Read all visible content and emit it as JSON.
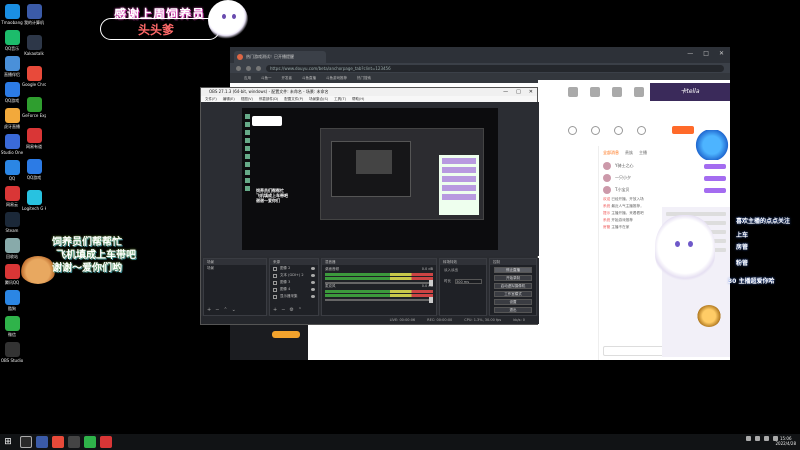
{
  "desktop": {
    "icons": [
      {
        "label": "Tmaobang",
        "color": "#1a8fe3"
      },
      {
        "label": "我的计算机",
        "color": "#3b5ba8"
      },
      {
        "label": "QQ音乐",
        "color": "#1cbc6b"
      },
      {
        "label": "Kakaotalk",
        "color": "#2d3748"
      },
      {
        "label": "直播伴侣",
        "color": "#4a90d9"
      },
      {
        "label": "Google Chrome",
        "color": "#e84a3a"
      },
      {
        "label": "QQ游戏",
        "color": "#2c7be5"
      },
      {
        "label": "GeForce Experience",
        "color": "#2f9e2f"
      },
      {
        "label": "虎牙直播",
        "color": "#f2a93b"
      },
      {
        "label": "网易有道",
        "color": "#d93636"
      },
      {
        "label": "Studio One",
        "color": "#3a6ad8"
      },
      {
        "label": "QQ",
        "color": "#2b86e4"
      },
      {
        "label": "QQ游戏",
        "color": "#2c7be5"
      },
      {
        "label": "网易云",
        "color": "#d93636"
      },
      {
        "label": "Logitech G HUB",
        "color": "#28c2e0"
      },
      {
        "label": "Steam",
        "color": "#1b2838"
      },
      {
        "label": "回收站",
        "color": "#8aa"
      },
      {
        "label": "腾讯QQ",
        "color": "#d93636"
      },
      {
        "label": "酷狗",
        "color": "#2b86e4"
      },
      {
        "label": "微信",
        "color": "#2fb34a"
      },
      {
        "label": "OBS Studio",
        "color": "#333"
      }
    ]
  },
  "overlay": {
    "thanks_title": "感谢上周饲养员",
    "thanks_name": "头头爹",
    "left_msg": [
      "饲养员们帮帮忙",
      "飞机填成上车带吧",
      "谢谢～爱你们哟"
    ],
    "follow_title": "喜欢主播的点点关注",
    "follow_lines": [
      "上车",
      "房管",
      "粉管"
    ],
    "follow_bottom": "30 主播超爱你哈",
    "banner_right": "卡tella"
  },
  "browser": {
    "tab_title": "热门游戏测试！已开播提醒",
    "url": "https://www.douyu.com/beta/anchorpage_tab?clint=123456",
    "bookmarks": [
      "应用",
      "斗鱼一",
      "开发者",
      "斗鱼直播",
      "斗鱼游戏推荐",
      "热门搜索"
    ],
    "window_controls": [
      "—",
      "□",
      "✕"
    ],
    "chat_tabs": [
      "全部消息",
      "贵族",
      "主播"
    ],
    "rank_rows": [
      "Y骑士之心",
      "一只小夕",
      "T小宝贝"
    ],
    "chat_messages": [
      {
        "who": "欢迎",
        "text": "已经开播，开放入场"
      },
      {
        "who": "系统",
        "text": "最近人气主播推荐，"
      },
      {
        "who": "提示",
        "text": "主播开播，来看看吧"
      },
      {
        "who": "系统",
        "text": "开始游戏推荐"
      },
      {
        "who": "房管",
        "text": "主播不在家"
      }
    ]
  },
  "obs": {
    "title": "OBS 27.1.3 (64-bit, windows) - 配置文件: 未命名 - 场景: 未命名",
    "menu": [
      "文件(F)",
      "编辑(E)",
      "视图(V)",
      "停靠部件(D)",
      "配置文件(P)",
      "场景集合(S)",
      "工具(T)",
      "帮助(H)"
    ],
    "preview_text": [
      "饲养员们帮帮忙",
      "飞机填成上车带吧",
      "谢谢～爱你们"
    ],
    "dock_titles": [
      "场景",
      "来源",
      "混音器",
      "转场特效",
      "控制"
    ],
    "scenes": [
      "场景"
    ],
    "sources": [
      "图像 2",
      "文本 (GDI+) 2",
      "图像 3",
      "图像 4",
      "显示器采集"
    ],
    "mixer": [
      {
        "name": "桌面音频",
        "value": "0.0 dB"
      },
      {
        "name": "麦克风",
        "value": "0.0 dB"
      }
    ],
    "transition": {
      "label": "淡入淡出",
      "duration_label": "时长",
      "duration": "300 ms"
    },
    "controls": [
      "停止直播",
      "开始录制",
      "启动虚拟摄像机",
      "工作室模式",
      "设置",
      "退出"
    ],
    "status": [
      "LIVE: 00:00:06",
      "REC: 00:00:00",
      "CPU: 1.3%, 30.00 fps",
      "kb/s: 0"
    ]
  },
  "taskbar": {
    "start_icon": "windows-logo-icon",
    "items": [
      "#3b5ba8",
      "#e84a3a",
      "#444",
      "#2fb34a",
      "#d93636"
    ],
    "time": "15:06",
    "date": "2022/4/28"
  }
}
